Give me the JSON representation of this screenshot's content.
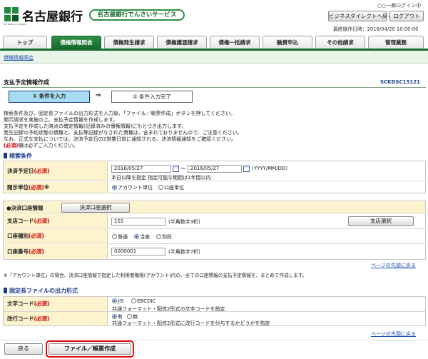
{
  "header": {
    "bank_name": "名古屋銀行",
    "logo_sub": "THE BANK OF NAGOYA",
    "service_title": "名古屋銀行でんさいサービス",
    "user_name": "○○一郎ログイン中",
    "btn_back_to_biz": "ビジネスダイレクトへ戻る",
    "btn_logout": "ログアウト",
    "last_operation": "最終操作日時：2016/04/20 10:00:00"
  },
  "tabs": [
    {
      "label": "トップ"
    },
    {
      "label": "債権情報照会"
    },
    {
      "label": "債権発生請求"
    },
    {
      "label": "債権譲渡請求"
    },
    {
      "label": "債権一括請求"
    },
    {
      "label": "融資申込"
    },
    {
      "label": "その他請求"
    },
    {
      "label": "管理業務"
    }
  ],
  "breadcrumb": "債権情報照会",
  "page": {
    "title": "支払予定情報作成",
    "screen_id": "SCKDSC15121"
  },
  "steps": {
    "step1": "① 条件を入力",
    "arrow": "⇒",
    "step2": "② 条件入力完了"
  },
  "instructions": {
    "line1": "検索条件及び、固定長ファイルの出力形式を入力後、「ファイル／帳票作成」ボタンを押してください。",
    "line2": "開示請求を実施の上、支払予定情報を作成します。",
    "line3": "支払予定を作成した時点の確定情報(記録済みの債権情報)にもとづき出力します。",
    "line4": "発生記録の予約状態の債権と、支払等記録がなされた債権は、含まれておりませんので、ご注意ください。",
    "line5": "なお、正式な支払については、決済予定日の2営業日前に通知される、決済情報通知をご確認ください。",
    "line6_req": "(必須)",
    "line6_rest": "欄は必ずご入力ください。"
  },
  "search": {
    "heading": "検索条件",
    "due_date_label": "決済予定日",
    "required_mark": "(必須)",
    "date_from": "2016/05/27",
    "tilde": "～",
    "date_to": "2016/05/27",
    "date_format": "(YYYY/MM/DD)",
    "date_note": "本日以降を指定 指定可能な期間は1年間以内",
    "disclosure_label": "開示単位",
    "note_mark": "※",
    "opt_account": "アカウント単位",
    "opt_account_selected": true,
    "opt_kouza": "口座単位"
  },
  "account": {
    "heading": "●決済口座情報",
    "btn_select": "決済口座選択",
    "branch_label": "支店コード",
    "branch_value": "101",
    "branch_hint": "(半角数字3桁)",
    "btn_branch_select": "支店選択",
    "type_label": "口座種別",
    "type_opts": [
      "普通",
      "当座",
      "別段"
    ],
    "type_selected": "当座",
    "number_label": "口座番号",
    "number_value": "0000001",
    "number_hint": "(半角数字7桁)"
  },
  "link_top": "ページの先頭に戻る",
  "footnote": "※「アカウント単位」の場合、決済口座情報で指定した利用者権限(アカウント)内の、全ての口座情報の支払予定情報を、まとめて作成します。",
  "output": {
    "heading": "固定長ファイルの出力形式",
    "charcode_label": "文字コード",
    "charcode_opts": [
      "JIS",
      "EBCDIC"
    ],
    "charcode_selected": "JIS",
    "charcode_note": "共通フォーマット・配信2形式の文字コードを指定",
    "newline_label": "改行コード",
    "newline_opts": [
      "有",
      "無"
    ],
    "newline_selected": "有",
    "newline_note": "共通フォーマット・配信2形式に改行コードを付与するかどうかを指定"
  },
  "footer": {
    "btn_back": "戻る",
    "btn_create": "ファイル／帳票作成"
  },
  "colors": {
    "brand_green": "#156b2b",
    "label_bg": "#fdf4cf",
    "required_red": "#d10000",
    "section_blue": "#1a3c8c",
    "highlight_red": "#e01010"
  }
}
